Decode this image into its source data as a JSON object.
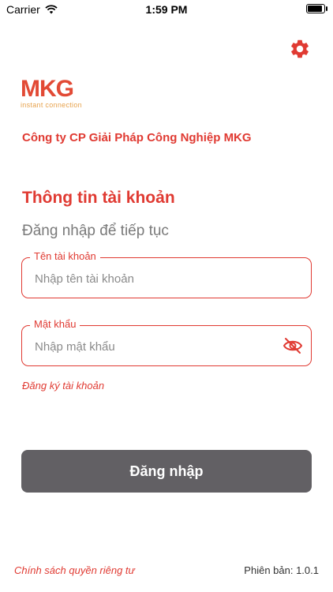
{
  "status_bar": {
    "carrier": "Carrier",
    "time": "1:59 PM"
  },
  "logo": {
    "text": "MKG",
    "tagline": "instant connection"
  },
  "company_name": "Công ty CP Giải Pháp Công Nghiệp MKG",
  "title": "Thông tin tài khoản",
  "subtitle": "Đăng nhập để tiếp tục",
  "username": {
    "label": "Tên tài khoản",
    "placeholder": "Nhập tên tài khoản",
    "value": ""
  },
  "password": {
    "label": "Mật khẩu",
    "placeholder": "Nhập mật khẩu",
    "value": ""
  },
  "register_link": "Đăng ký tài khoản",
  "login_button": "Đăng nhập",
  "privacy_link": "Chính sách quyền riêng tư",
  "version": "Phiên bản: 1.0.1",
  "colors": {
    "accent": "#e03a32",
    "button": "#626064",
    "logo_orange": "#e7a24c"
  },
  "icons": [
    "wifi-icon",
    "battery-icon",
    "gear-icon",
    "eye-off-icon"
  ]
}
